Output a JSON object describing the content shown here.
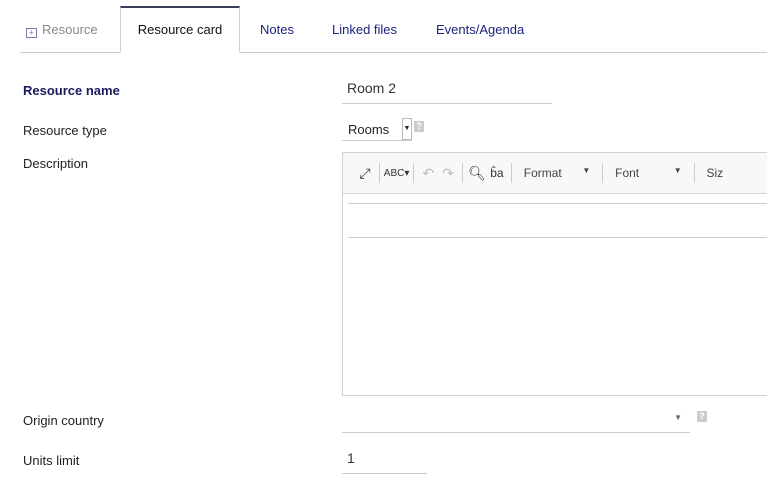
{
  "tabs": [
    {
      "label": "Resource"
    },
    {
      "label": "Resource card"
    },
    {
      "label": "Notes"
    },
    {
      "label": "Linked files"
    },
    {
      "label": "Events/Agenda"
    }
  ],
  "form": {
    "resource_name_label": "Resource name",
    "resource_name_value": "Room 2",
    "resource_type_label": "Resource type",
    "resource_type_value": "Rooms",
    "description_label": "Description",
    "origin_country_label": "Origin country",
    "origin_country_value": "",
    "units_limit_label": "Units limit",
    "units_limit_value": "1",
    "help": "?"
  },
  "editor": {
    "format": "Format",
    "font": "Font",
    "size": "Siz"
  }
}
